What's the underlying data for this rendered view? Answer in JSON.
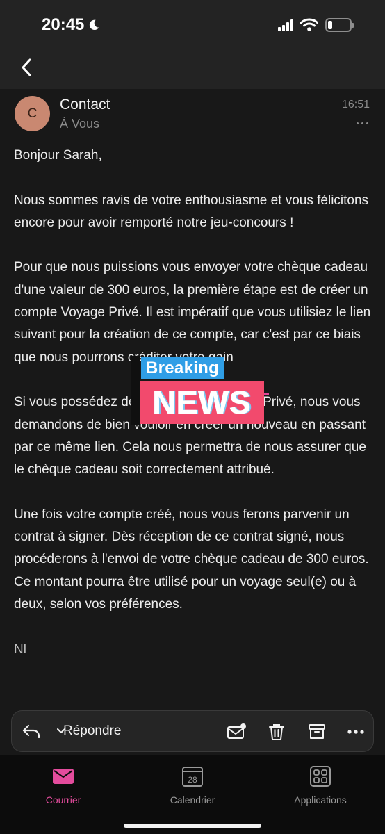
{
  "status_bar": {
    "time": "20:45",
    "battery_level": 0.2
  },
  "email": {
    "sender_initial": "C",
    "sender_name": "Contact",
    "recipient": "À Vous",
    "time": "16:51",
    "paragraphs": [
      "Bonjour Sarah,",
      "Nous sommes ravis de votre enthousiasme et vous félicitons encore pour avoir remporté notre jeu-concours !",
      "Pour que nous puissions vous envoyer votre chèque cadeau d'une valeur de 300 euros, la première étape est de créer un compte Voyage Privé. Il est impératif que vous utilisiez le lien suivant pour la création de ce compte, car c'est par ce biais que nous pourrons créditer votre gain",
      "Si vous possédez déjà un compte Voyage Privé, nous vous demandons de bien vouloir en créer un nouveau en passant par ce même lien. Cela nous permettra de nous assurer que le chèque cadeau soit correctement attribué.",
      "Une fois votre compte créé, nous vous ferons parvenir un contrat à signer. Dès réception de ce contrat signé, nous procéderons à l'envoi de votre chèque cadeau de 300 euros. Ce montant pourra être utilisé pour un voyage seul(e) ou à deux, selon vos préférences."
    ],
    "trailing_fragment": "Nl"
  },
  "sticker": {
    "top_text": "Breaking",
    "bottom_text": "NEWS"
  },
  "toolbar": {
    "reply_label": "Répondre"
  },
  "tabs": [
    {
      "label": "Courrier",
      "active": true
    },
    {
      "label": "Calendrier",
      "day": "28",
      "active": false
    },
    {
      "label": "Applications",
      "active": false
    }
  ],
  "colors": {
    "accent": "#e44c9d",
    "avatar": "#c98871",
    "sticker_blue": "#2f9ee6",
    "sticker_red": "#f24a6d"
  }
}
